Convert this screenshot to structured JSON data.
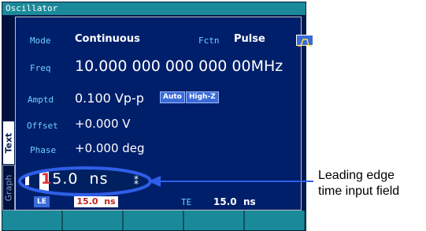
{
  "window": {
    "title": "Oscillator"
  },
  "rows": {
    "mode": {
      "label": "Mode",
      "value": "Continuous"
    },
    "fctn": {
      "label": "Fctn",
      "value": "Pulse",
      "icon": "pulse-waveform-icon"
    },
    "freq": {
      "label": "Freq",
      "value": "10.000 000 000 000 00MHz"
    },
    "amptd": {
      "label": "Amptd",
      "value": "0.100 Vp-p",
      "badges": [
        "Auto",
        "High-Z"
      ]
    },
    "offset": {
      "label": "Offset",
      "value": "+0.000 V"
    },
    "phase": {
      "label": "Phase",
      "value": "+0.000 deg"
    }
  },
  "edit_field": {
    "first_digit": "1",
    "rest": "5.0  ns"
  },
  "bottom": {
    "le": {
      "label": "LE",
      "value": "15.0  ns"
    },
    "te": {
      "label": "TE",
      "value": "15.0  ns"
    }
  },
  "tabs": {
    "text": "Text",
    "graph": "Graph"
  },
  "callout": {
    "line1": "Leading edge",
    "line2": "time input field"
  },
  "colors": {
    "title_bar": "#1a8a9a",
    "panel_bg": "#001f6b",
    "label": "#6fd0ff",
    "highlight_ring": "#2f5fe8",
    "badge": "#3a6bd8"
  }
}
